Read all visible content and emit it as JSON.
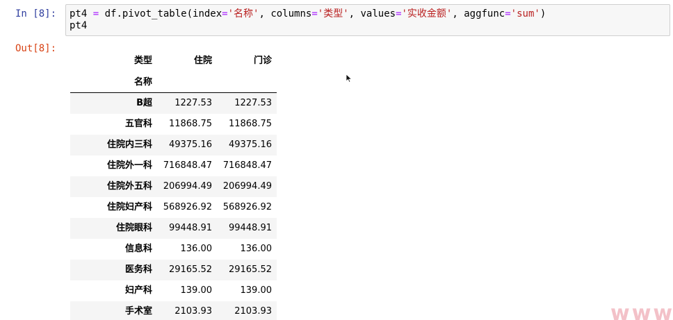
{
  "input_cell": {
    "prompt": "In [8]:",
    "code": {
      "var": "pt4",
      "assign": " = ",
      "call_start": "df.pivot_table(index",
      "eq1": "=",
      "index_val": "'名称'",
      "sep1": ", columns",
      "eq2": "=",
      "columns_val": "'类型'",
      "sep2": ", values",
      "eq3": "=",
      "values_val": "'实收金额'",
      "sep3": ", aggfunc",
      "eq4": "=",
      "aggfunc_val": "'sum'",
      "call_end": ")",
      "line2": "pt4"
    }
  },
  "output_cell": {
    "prompt": "Out[8]:",
    "table": {
      "columns_name": "类型",
      "index_name": "名称",
      "columns": [
        "住院",
        "门诊"
      ],
      "rows": [
        {
          "index": "B超",
          "values": [
            "1227.53",
            "1227.53"
          ]
        },
        {
          "index": "五官科",
          "values": [
            "11868.75",
            "11868.75"
          ]
        },
        {
          "index": "住院内三科",
          "values": [
            "49375.16",
            "49375.16"
          ]
        },
        {
          "index": "住院外一科",
          "values": [
            "716848.47",
            "716848.47"
          ]
        },
        {
          "index": "住院外五科",
          "values": [
            "206994.49",
            "206994.49"
          ]
        },
        {
          "index": "住院妇产科",
          "values": [
            "568926.92",
            "568926.92"
          ]
        },
        {
          "index": "住院眼科",
          "values": [
            "99448.91",
            "99448.91"
          ]
        },
        {
          "index": "信息科",
          "values": [
            "136.00",
            "136.00"
          ]
        },
        {
          "index": "医务科",
          "values": [
            "29165.52",
            "29165.52"
          ]
        },
        {
          "index": "妇产科",
          "values": [
            "139.00",
            "139.00"
          ]
        },
        {
          "index": "手术室",
          "values": [
            "2103.93",
            "2103.93"
          ]
        }
      ]
    }
  },
  "watermark": "www.i",
  "cursor_icon": "mouse-pointer-icon",
  "colors": {
    "in_prompt": "#303f9f",
    "out_prompt": "#d84315",
    "string": "#ba2121",
    "operator": "#aa22ff",
    "stripe": "#f5f5f5"
  }
}
